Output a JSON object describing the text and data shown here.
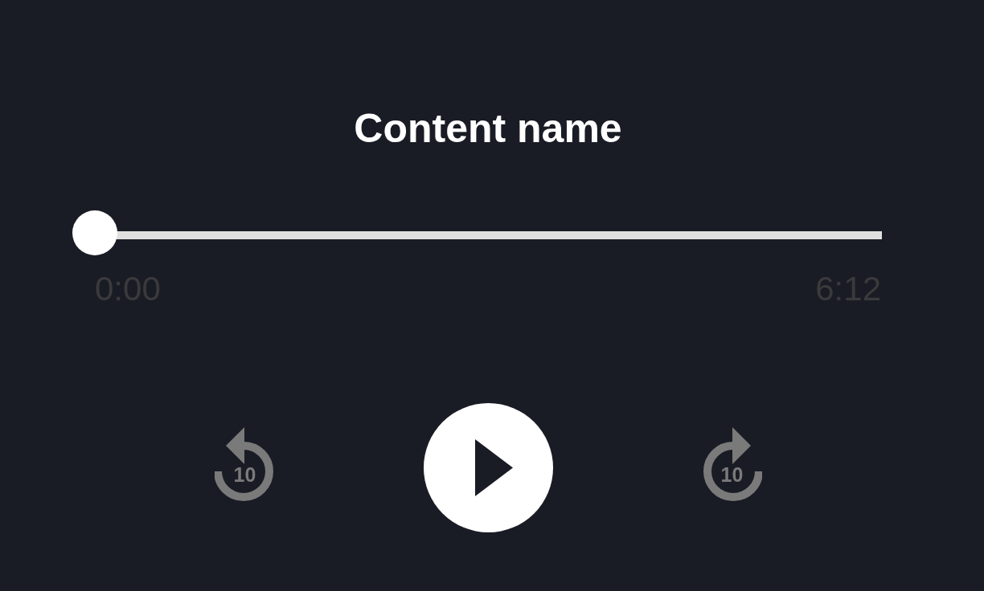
{
  "title": "Content name",
  "progress": {
    "level": 0,
    "elapsed": "0:00",
    "duration": "6:12"
  },
  "controls": [
    {
      "kind": "skip_back",
      "label": "10"
    },
    {
      "kind": "play",
      "playing": false
    },
    {
      "kind": "skip_forward",
      "label": "10"
    }
  ]
}
